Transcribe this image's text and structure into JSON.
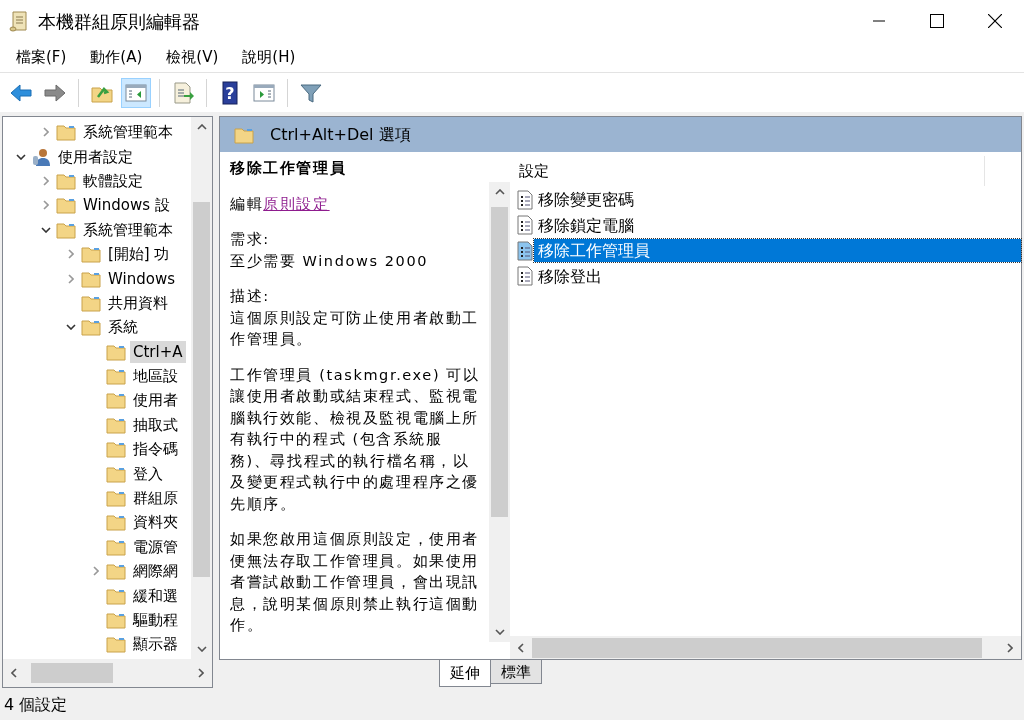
{
  "window": {
    "title": "本機群組原則編輯器"
  },
  "menu": [
    "檔案(F)",
    "動作(A)",
    "檢視(V)",
    "說明(H)"
  ],
  "toolbar": [
    {
      "kind": "back",
      "pressed": false
    },
    {
      "kind": "forward",
      "pressed": false
    },
    {
      "kind": "sep"
    },
    {
      "kind": "up",
      "pressed": false
    },
    {
      "kind": "tree",
      "pressed": true
    },
    {
      "kind": "sep"
    },
    {
      "kind": "export",
      "pressed": false
    },
    {
      "kind": "sep"
    },
    {
      "kind": "help",
      "label": "?",
      "pressed": false
    },
    {
      "kind": "pane",
      "pressed": false
    },
    {
      "kind": "sep"
    },
    {
      "kind": "filter",
      "pressed": false
    }
  ],
  "tree": [
    {
      "children": [
        {
          "label": "系統管理範本",
          "kind": "folder",
          "expanded": false,
          "selected": false
        }
      ]
    },
    {
      "label": "使用者設定",
      "kind": "user",
      "expanded": true,
      "selected": false,
      "children": [
        {
          "label": "軟體設定",
          "kind": "folder",
          "expanded": false,
          "selected": false
        },
        {
          "label": "Windows 設",
          "kind": "folder",
          "expanded": false,
          "selected": false
        },
        {
          "label": "系統管理範本",
          "kind": "folder",
          "expanded": true,
          "selected": false,
          "children": [
            {
              "label": "[開始] 功",
              "kind": "folder",
              "expanded": false,
              "selected": false
            },
            {
              "label": "Windows",
              "kind": "folder",
              "expanded": false,
              "selected": false
            },
            {
              "label": "共用資料",
              "kind": "folder",
              "selected": false
            },
            {
              "label": "系統",
              "kind": "folder",
              "expanded": true,
              "selected": false,
              "children": [
                {
                  "label": "Ctrl+A",
                  "kind": "folder",
                  "selected": true
                },
                {
                  "label": "地區設",
                  "kind": "folder",
                  "selected": false
                },
                {
                  "label": "使用者",
                  "kind": "folder",
                  "selected": false
                },
                {
                  "label": "抽取式",
                  "kind": "folder",
                  "selected": false
                },
                {
                  "label": "指令碼",
                  "kind": "folder",
                  "selected": false
                },
                {
                  "label": "登入",
                  "kind": "folder",
                  "selected": false
                },
                {
                  "label": "群組原",
                  "kind": "folder",
                  "selected": false
                },
                {
                  "label": "資料夾",
                  "kind": "folder",
                  "selected": false
                },
                {
                  "label": "電源管",
                  "kind": "folder",
                  "selected": false
                },
                {
                  "label": "網際網",
                  "kind": "folder",
                  "expanded": false,
                  "selected": false
                },
                {
                  "label": "緩和選",
                  "kind": "folder",
                  "selected": false
                },
                {
                  "label": "驅動程",
                  "kind": "folder",
                  "selected": false
                },
                {
                  "label": "顯示器",
                  "kind": "folder",
                  "selected": false
                }
              ]
            }
          ]
        }
      ]
    }
  ],
  "header": {
    "title": "Ctrl+Alt+Del 選項"
  },
  "description": {
    "title": "移除工作管理員",
    "edit_prefix": "編輯",
    "edit_link": "原則設定",
    "requirement_label": "需求:",
    "requirement": "至少需要 Windows 2000",
    "description_label": "描述:",
    "paragraphs": [
      "這個原則設定可防止使用者啟動工作管理員。",
      "工作管理員 (taskmgr.exe) 可以讓使用者啟動或結束程式、監視電腦執行效能、檢視及監視電腦上所有執行中的程式 (包含系統服務)、尋找程式的執行檔名稱，以及變更程式執行中的處理程序之優先順序。",
      "如果您啟用這個原則設定，使用者便無法存取工作管理員。如果使用者嘗試啟動工作管理員，會出現訊息，說明某個原則禁止執行這個動作。"
    ]
  },
  "settings": {
    "column": "設定",
    "items": [
      {
        "label": "移除變更密碼",
        "selected": false
      },
      {
        "label": "移除鎖定電腦",
        "selected": false
      },
      {
        "label": "移除工作管理員",
        "selected": true
      },
      {
        "label": "移除登出",
        "selected": false
      }
    ]
  },
  "tabs": [
    {
      "label": "延伸",
      "selected": true
    },
    {
      "label": "標準",
      "selected": false
    }
  ],
  "status_bar": "4 個設定"
}
